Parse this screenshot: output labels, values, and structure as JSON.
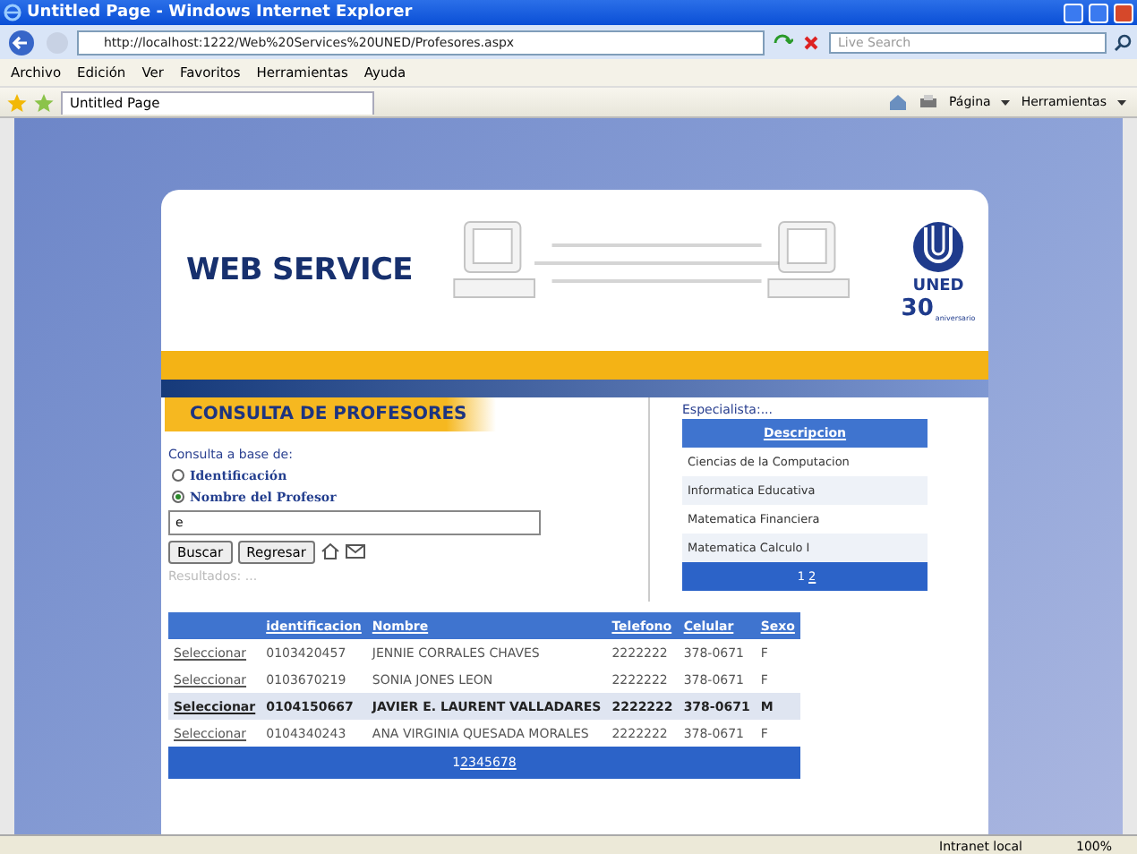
{
  "window": {
    "title": "Untitled Page - Windows Internet Explorer"
  },
  "address_bar": {
    "url": "http://localhost:1222/Web%20Services%20UNED/Profesores.aspx",
    "search_placeholder": "Live Search"
  },
  "menu": [
    "Archivo",
    "Edición",
    "Ver",
    "Favoritos",
    "Herramientas",
    "Ayuda"
  ],
  "tab": {
    "title": "Untitled Page"
  },
  "command_bar": [
    "Página",
    "Herramientas"
  ],
  "header": {
    "title": "WEB SERVICE",
    "logo_text": "UNED",
    "logo_years": "30",
    "logo_caption": "aniversario"
  },
  "consulta": {
    "title": "CONSULTA DE PROFESORES",
    "prompt": "Consulta a base de:",
    "options": [
      {
        "label": "Identificación",
        "selected": false
      },
      {
        "label": "Nombre del Profesor",
        "selected": true
      }
    ],
    "search_value": "e",
    "buttons": [
      "Buscar",
      "Regresar"
    ],
    "results_label": "Resultados: ..."
  },
  "especialista": {
    "label": "Especialista:...",
    "column": "Descripcion",
    "rows": [
      "Ciencias de la Computacion",
      "Informatica Educativa",
      "Matematica Financiera",
      "Matematica Calculo I"
    ],
    "pages": [
      {
        "label": "1",
        "selected": true
      },
      {
        "label": "2",
        "selected": false
      }
    ]
  },
  "table": {
    "columns": [
      "",
      "identificacion",
      "Nombre",
      "Telefono",
      "Celular",
      "Sexo"
    ],
    "rows": [
      {
        "cells": [
          "Seleccionar",
          "0103420457",
          "JENNIE CORRALES CHAVES",
          "2222222",
          "378-0671",
          "F"
        ],
        "selected": false
      },
      {
        "cells": [
          "Seleccionar",
          "0103670219",
          "SONIA JONES LEON",
          "2222222",
          "378-0671",
          "F"
        ],
        "selected": false
      },
      {
        "cells": [
          "Seleccionar",
          "0104150667",
          "JAVIER E. LAURENT VALLADARES",
          "2222222",
          "378-0671",
          "M"
        ],
        "selected": true
      },
      {
        "cells": [
          "Seleccionar",
          "0104340243",
          "ANA VIRGINIA QUESADA MORALES",
          "2222222",
          "378-0671",
          "F"
        ],
        "selected": false
      }
    ],
    "pages": [
      {
        "label": "1",
        "selected": true
      },
      {
        "label": "2",
        "selected": false
      },
      {
        "label": "3",
        "selected": false
      },
      {
        "label": "4",
        "selected": false
      },
      {
        "label": "5",
        "selected": false
      },
      {
        "label": "6",
        "selected": false
      },
      {
        "label": "7",
        "selected": false
      },
      {
        "label": "8",
        "selected": false
      }
    ]
  },
  "status_bar": {
    "zone": "Intranet local",
    "zoom": "100%"
  }
}
